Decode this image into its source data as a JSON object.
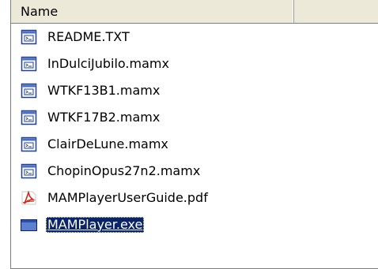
{
  "columns": {
    "name_label": "Name"
  },
  "files": [
    {
      "name": "README.TXT",
      "icon": "document-icon"
    },
    {
      "name": "InDulciJubilo.mamx",
      "icon": "document-icon"
    },
    {
      "name": "WTKF13B1.mamx",
      "icon": "document-icon"
    },
    {
      "name": "WTKF17B2.mamx",
      "icon": "document-icon"
    },
    {
      "name": "ClairDeLune.mamx",
      "icon": "document-icon"
    },
    {
      "name": "ChopinOpus27n2.mamx",
      "icon": "document-icon"
    },
    {
      "name": "MAMPlayerUserGuide.pdf",
      "icon": "pdf-icon"
    },
    {
      "name": "MAMPlayer.exe",
      "icon": "application-icon",
      "selected": true
    }
  ],
  "colors": {
    "selection": "#0a246a",
    "header": "#ece9d8",
    "pdf": "#d42a1a"
  }
}
